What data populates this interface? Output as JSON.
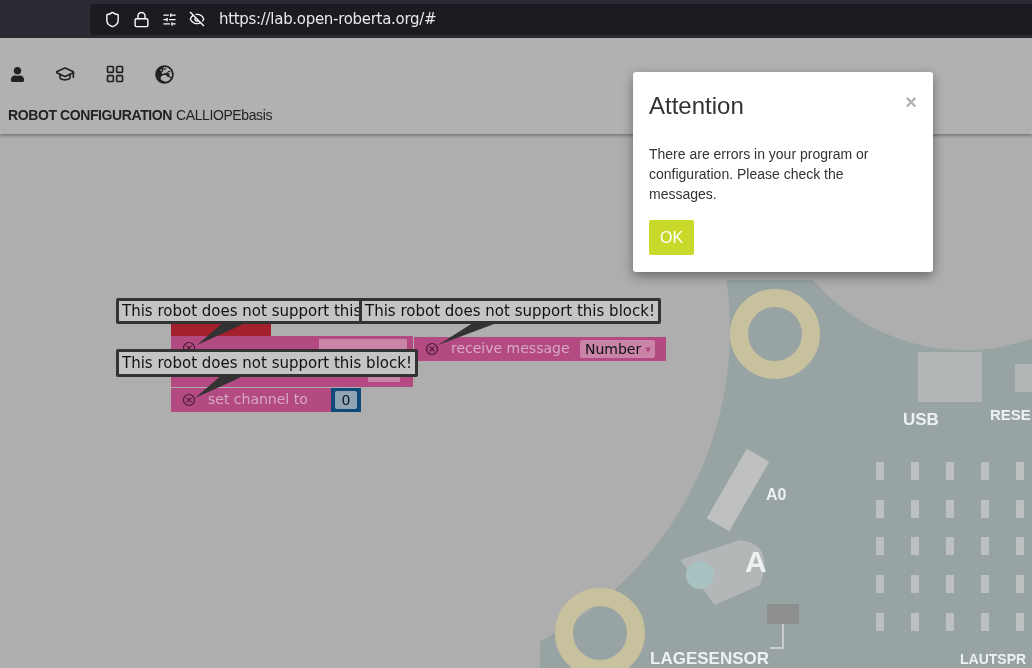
{
  "browser": {
    "url": "https://lab.open-roberta.org/#"
  },
  "header": {
    "title": "ROBOT CONFIGURATION",
    "robot": "CALLIOPEbasis"
  },
  "blocks": [
    {
      "kind": "event"
    },
    {
      "kind": "send"
    },
    {
      "kind": "channel",
      "label": "set channel to",
      "value": "0"
    },
    {
      "kind": "receive",
      "label": "receive message",
      "dropdown": "Number",
      "arrow": "▾"
    }
  ],
  "tooltips": [
    "This robot does not support this",
    "This robot does not support this block!",
    "This robot does not support this block!"
  ],
  "board": {
    "labels": [
      "USB",
      "RESE",
      "A0",
      "A",
      "LAGESENSOR",
      "LAUTSPR"
    ]
  },
  "dialog": {
    "title": "Attention",
    "close": "×",
    "message": "There are errors in your program or configuration. Please check the messages.",
    "button": "OK"
  }
}
